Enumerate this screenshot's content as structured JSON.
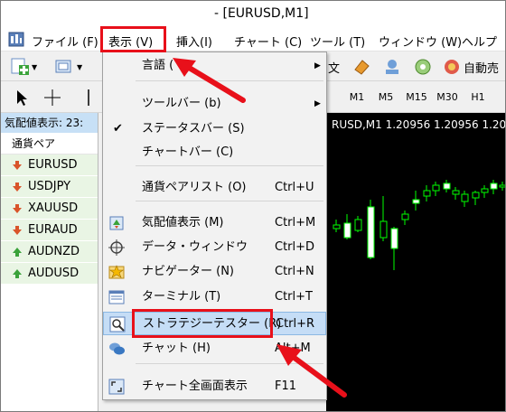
{
  "window": {
    "title": "- [EURUSD,M1]"
  },
  "menubar": {
    "items": [
      "ファイル (F)",
      "表示 (V)",
      "挿入(I)",
      "チャート (C)",
      "ツール (T)",
      "ウィンドウ (W)",
      "ヘルプ"
    ]
  },
  "toolbar": {
    "partial_text": "文",
    "auto_trade_label": "自動売",
    "timeframes": [
      "M1",
      "M5",
      "M15",
      "M30",
      "H1"
    ],
    "selected_timeframe": "M1"
  },
  "market_watch": {
    "header": "気配値表示: 23:",
    "column_header": "通貨ペア",
    "rows": [
      {
        "symbol": "EURUSD",
        "direction": "down"
      },
      {
        "symbol": "USDJPY",
        "direction": "down"
      },
      {
        "symbol": "XAUUSD",
        "direction": "down"
      },
      {
        "symbol": "EURAUD",
        "direction": "down"
      },
      {
        "symbol": "AUDNZD",
        "direction": "up"
      },
      {
        "symbol": "AUDUSD",
        "direction": "up"
      }
    ]
  },
  "chart": {
    "label": "RUSD,M1  1.20956 1.20956 1.2088",
    "colors": {
      "background": "#000000",
      "candle": "#00ff00"
    }
  },
  "view_menu": {
    "items": [
      {
        "label": "言語 (",
        "shortcut": "",
        "submenu": true,
        "icon": ""
      },
      {
        "label": "ツールバー (b)",
        "shortcut": "",
        "submenu": true,
        "icon": ""
      },
      {
        "label": "ステータスバー (S)",
        "shortcut": "",
        "submenu": false,
        "icon": "checkmark"
      },
      {
        "label": "チャートバー (C)",
        "shortcut": "",
        "submenu": false,
        "icon": ""
      },
      {
        "label": "通貨ペアリスト (O)",
        "shortcut": "Ctrl+U",
        "submenu": false,
        "icon": ""
      },
      {
        "label": "気配値表示 (M)",
        "shortcut": "Ctrl+M",
        "submenu": false,
        "icon": "market-watch-icon"
      },
      {
        "label": "データ・ウィンドウ",
        "shortcut": "Ctrl+D",
        "submenu": false,
        "icon": "crosshair-icon"
      },
      {
        "label": "ナビゲーター (N)",
        "shortcut": "Ctrl+N",
        "submenu": false,
        "icon": "navigator-star-icon"
      },
      {
        "label": "ターミナル (T)",
        "shortcut": "Ctrl+T",
        "submenu": false,
        "icon": "terminal-icon"
      },
      {
        "label": "ストラテジーテスター (R)",
        "shortcut": "Ctrl+R",
        "submenu": false,
        "icon": "strategy-tester-icon"
      },
      {
        "label": "チャット (H)",
        "shortcut": "Alt+M",
        "submenu": false,
        "icon": "chat-icon"
      },
      {
        "label": "チャート全画面表示",
        "shortcut": "F11",
        "submenu": false,
        "icon": "fullscreen-icon"
      }
    ],
    "highlighted_item": "ストラテジーテスター (R)"
  },
  "colors": {
    "highlight_box": "#e8101a",
    "menu_active_bg": "#c5ddf6",
    "market_row_bg": "#e9f5e4",
    "down_arrow": "#d9542a",
    "up_arrow": "#3aa23a"
  }
}
